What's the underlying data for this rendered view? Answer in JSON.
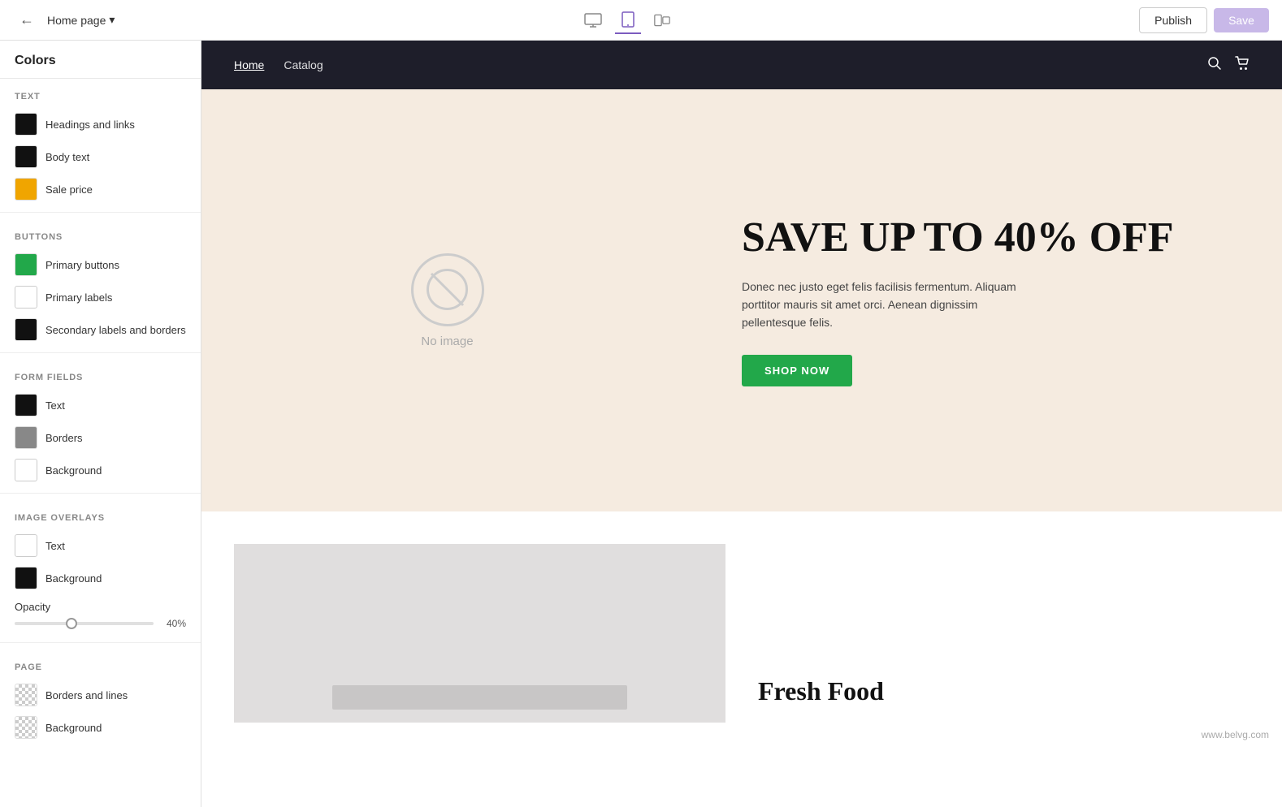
{
  "topbar": {
    "back_label": "←",
    "page_label": "Home page",
    "chevron": "▾",
    "publish_label": "Publish",
    "save_label": "Save",
    "view_desktop_icon": "🖥",
    "view_tablet_icon": "⬜",
    "view_mobile_icon": "⊞"
  },
  "sidebar": {
    "title": "Colors",
    "sections": [
      {
        "label": "TEXT",
        "items": [
          {
            "name": "Headings and links",
            "color": "#111111",
            "type": "solid"
          },
          {
            "name": "Body text",
            "color": "#111111",
            "type": "solid"
          },
          {
            "name": "Sale price",
            "color": "#f0a500",
            "type": "solid"
          }
        ]
      },
      {
        "label": "BUTTONS",
        "items": [
          {
            "name": "Primary buttons",
            "color": "#22a84a",
            "type": "solid"
          },
          {
            "name": "Primary labels",
            "color": "#ffffff",
            "type": "solid",
            "border": true
          },
          {
            "name": "Secondary labels and borders",
            "color": "#111111",
            "type": "solid"
          }
        ]
      },
      {
        "label": "FORM FIELDS",
        "items": [
          {
            "name": "Text",
            "color": "#111111",
            "type": "solid"
          },
          {
            "name": "Borders",
            "color": "#888888",
            "type": "solid"
          },
          {
            "name": "Background",
            "color": "#ffffff",
            "type": "solid",
            "border": true
          }
        ]
      },
      {
        "label": "IMAGE OVERLAYS",
        "items": [
          {
            "name": "Text",
            "color": "#ffffff",
            "type": "solid",
            "border": true
          },
          {
            "name": "Background",
            "color": "#111111",
            "type": "solid"
          }
        ]
      }
    ],
    "opacity": {
      "label": "Opacity",
      "value": 40,
      "display": "40%"
    },
    "page_section": {
      "label": "PAGE",
      "items": [
        {
          "name": "Borders and lines",
          "color": null,
          "type": "checkered"
        },
        {
          "name": "Background",
          "color": null,
          "type": "checkered"
        }
      ]
    }
  },
  "preview": {
    "nav": {
      "links": [
        "Home",
        "Catalog"
      ],
      "active": "Home"
    },
    "hero": {
      "no_image_text": "No image",
      "title": "SAVE UP TO 40% OFF",
      "description": "Donec nec justo eget felis facilisis fermentum. Aliquam porttitor mauris sit amet orci. Aenean dignissim pellentesque felis.",
      "cta": "SHOP NOW"
    },
    "second": {
      "title": "Fresh Food"
    },
    "watermark": "www.belvg.com"
  }
}
